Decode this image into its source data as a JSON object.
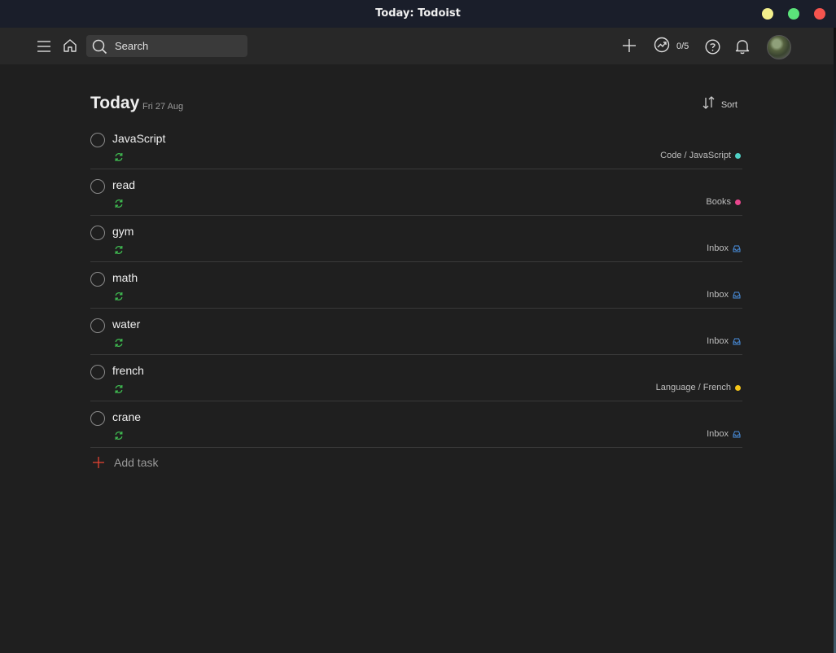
{
  "window": {
    "title": "Today: Todoist",
    "controls": {
      "minimize_color": "#f3ef8c",
      "maximize_color": "#5be37a",
      "close_color": "#f5544e"
    }
  },
  "topbar": {
    "search_placeholder": "Search",
    "icons": [
      "menu-icon",
      "home-icon",
      "search-icon",
      "add-icon",
      "productivity-icon",
      "help-icon",
      "notifications-icon"
    ],
    "karma_progress": "0/5"
  },
  "today": {
    "title": "Today",
    "date": "Fri 27 Aug",
    "sort_label": "Sort"
  },
  "tasks": [
    {
      "name": "JavaScript",
      "project": "Code / JavaScript",
      "project_color": "#4fd1c5",
      "project_icon": "dot"
    },
    {
      "name": "read",
      "project": "Books",
      "project_color": "#e8468d",
      "project_icon": "dot"
    },
    {
      "name": "gym",
      "project": "Inbox",
      "project_color": "#4a90e2",
      "project_icon": "inbox-icon"
    },
    {
      "name": "math",
      "project": "Inbox",
      "project_color": "#4a90e2",
      "project_icon": "inbox-icon"
    },
    {
      "name": "water",
      "project": "Inbox",
      "project_color": "#4a90e2",
      "project_icon": "inbox-icon"
    },
    {
      "name": "french",
      "project": "Language / French",
      "project_color": "#f5c518",
      "project_icon": "dot"
    },
    {
      "name": "crane",
      "project": "Inbox",
      "project_color": "#4a90e2",
      "project_icon": "inbox-icon"
    }
  ],
  "add_task_label": "Add task",
  "colors": {
    "accent_red": "#e44332",
    "recurring_green": "#3fb950",
    "background": "#1f1f1f",
    "topbar": "#282828"
  }
}
